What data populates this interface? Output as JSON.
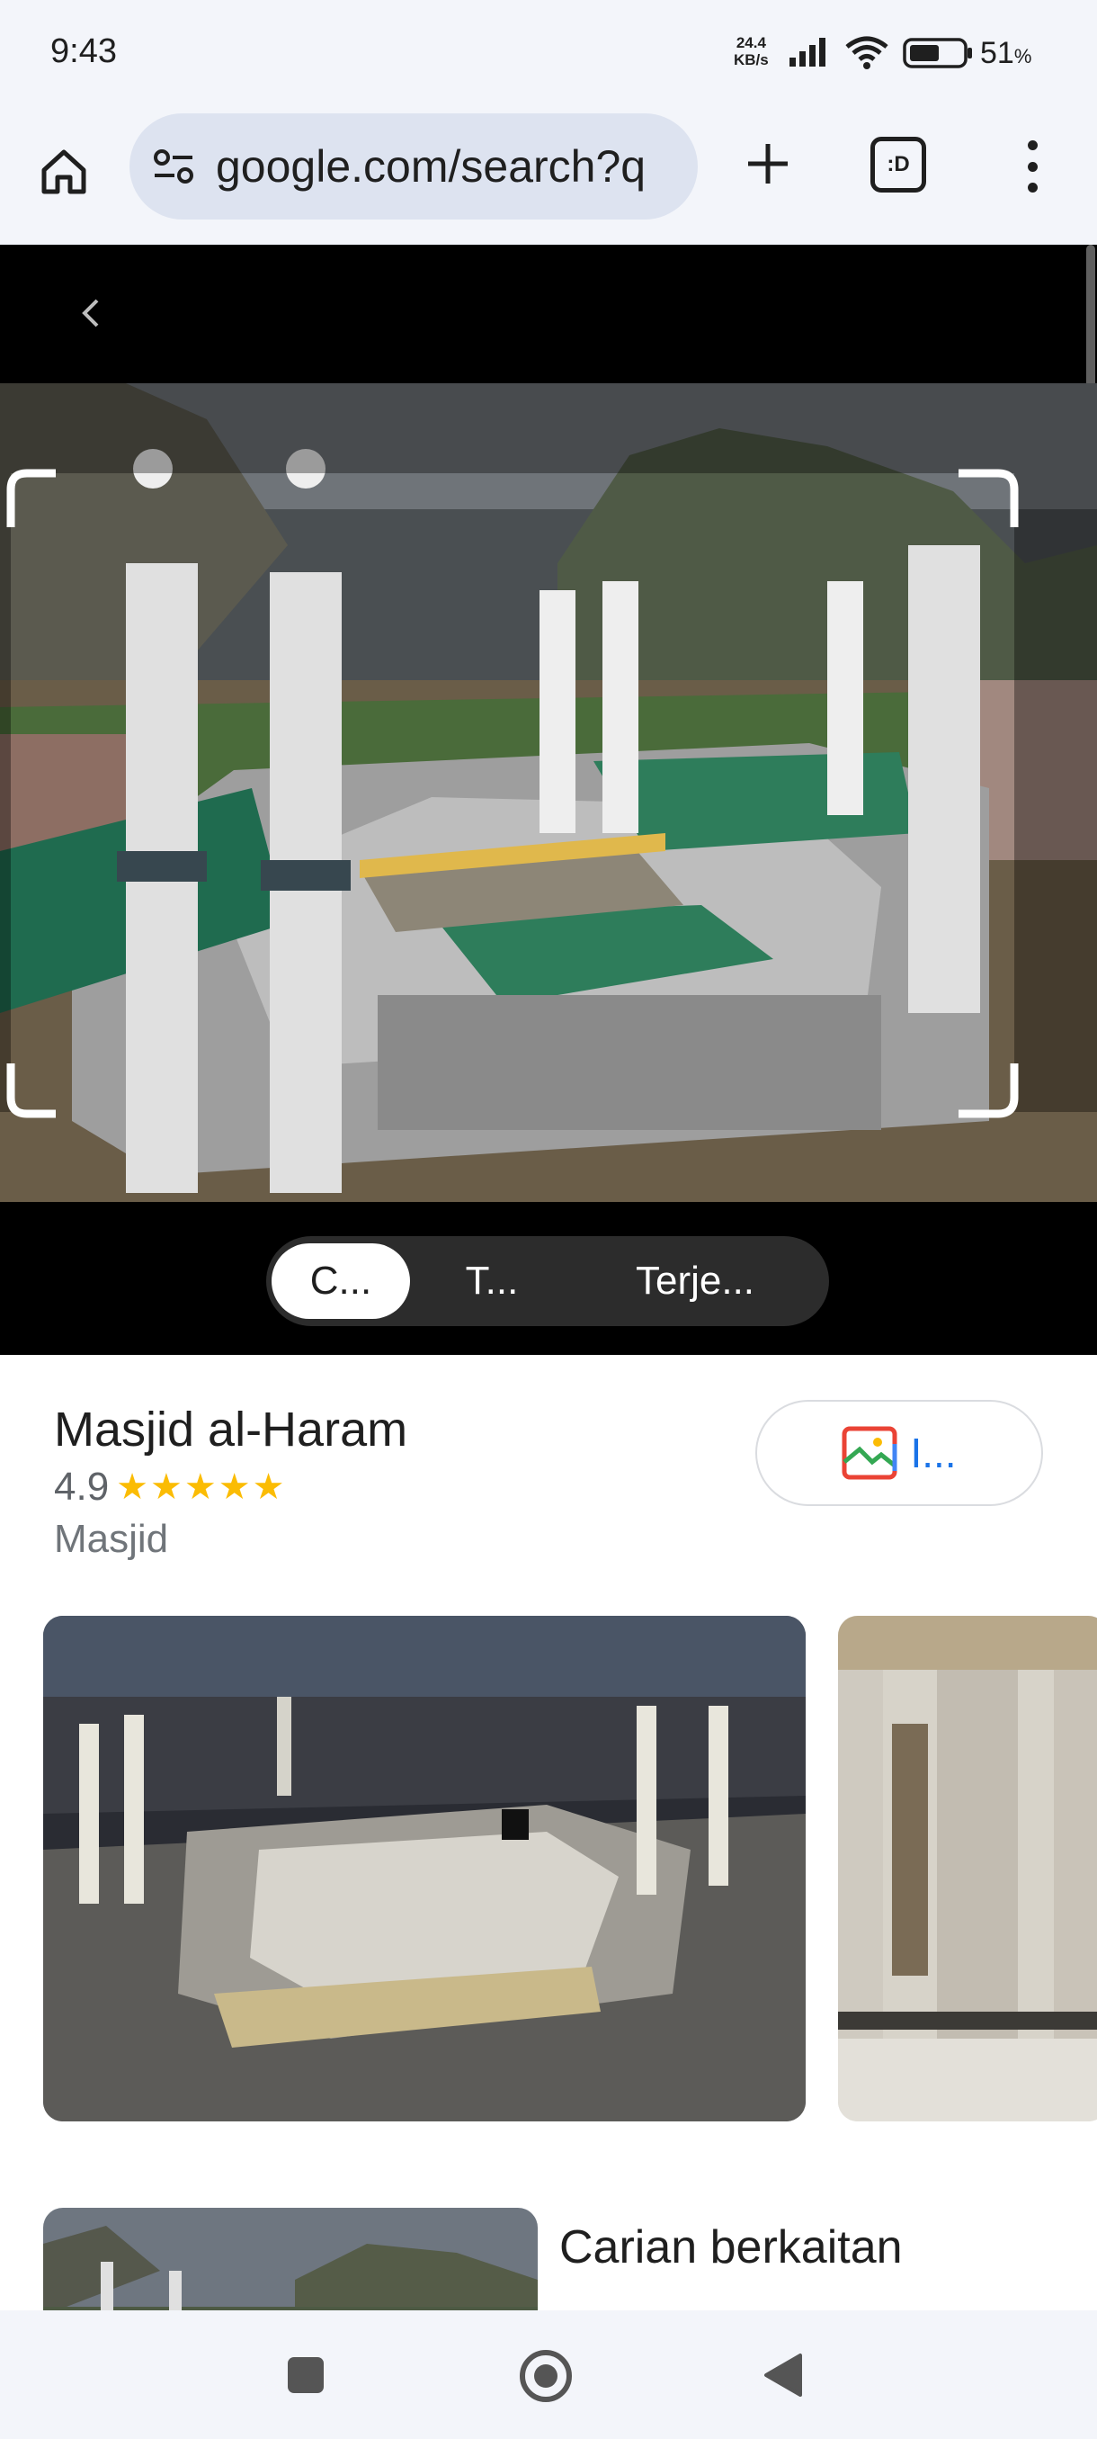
{
  "status_bar": {
    "time": "9:43",
    "net_speed_value": "24.4",
    "net_speed_unit": "KB/s",
    "battery_percent": "51",
    "battery_unit": "%"
  },
  "browser": {
    "url": "google.com/search?q",
    "tabs_label": ":D",
    "icons": [
      "home-icon",
      "tune-icon",
      "plus-icon",
      "tab-switcher-icon",
      "more-vert-icon"
    ]
  },
  "lens": {
    "tabs": [
      {
        "label": "C...",
        "active": true
      },
      {
        "label": "T...",
        "active": false
      },
      {
        "label": "Terje...",
        "active": false
      }
    ]
  },
  "result": {
    "title": "Masjid al-Haram",
    "rating": "4.9",
    "stars": 5,
    "category": "Masjid",
    "image_button_label": "I..."
  },
  "related": {
    "title": "Carian berkaitan"
  },
  "colors": {
    "accent_blue": "#1a73e8",
    "star_yellow": "#fbbc04",
    "chrome_bg": "#f3f5fa",
    "url_bar_bg": "#dde3f0"
  }
}
